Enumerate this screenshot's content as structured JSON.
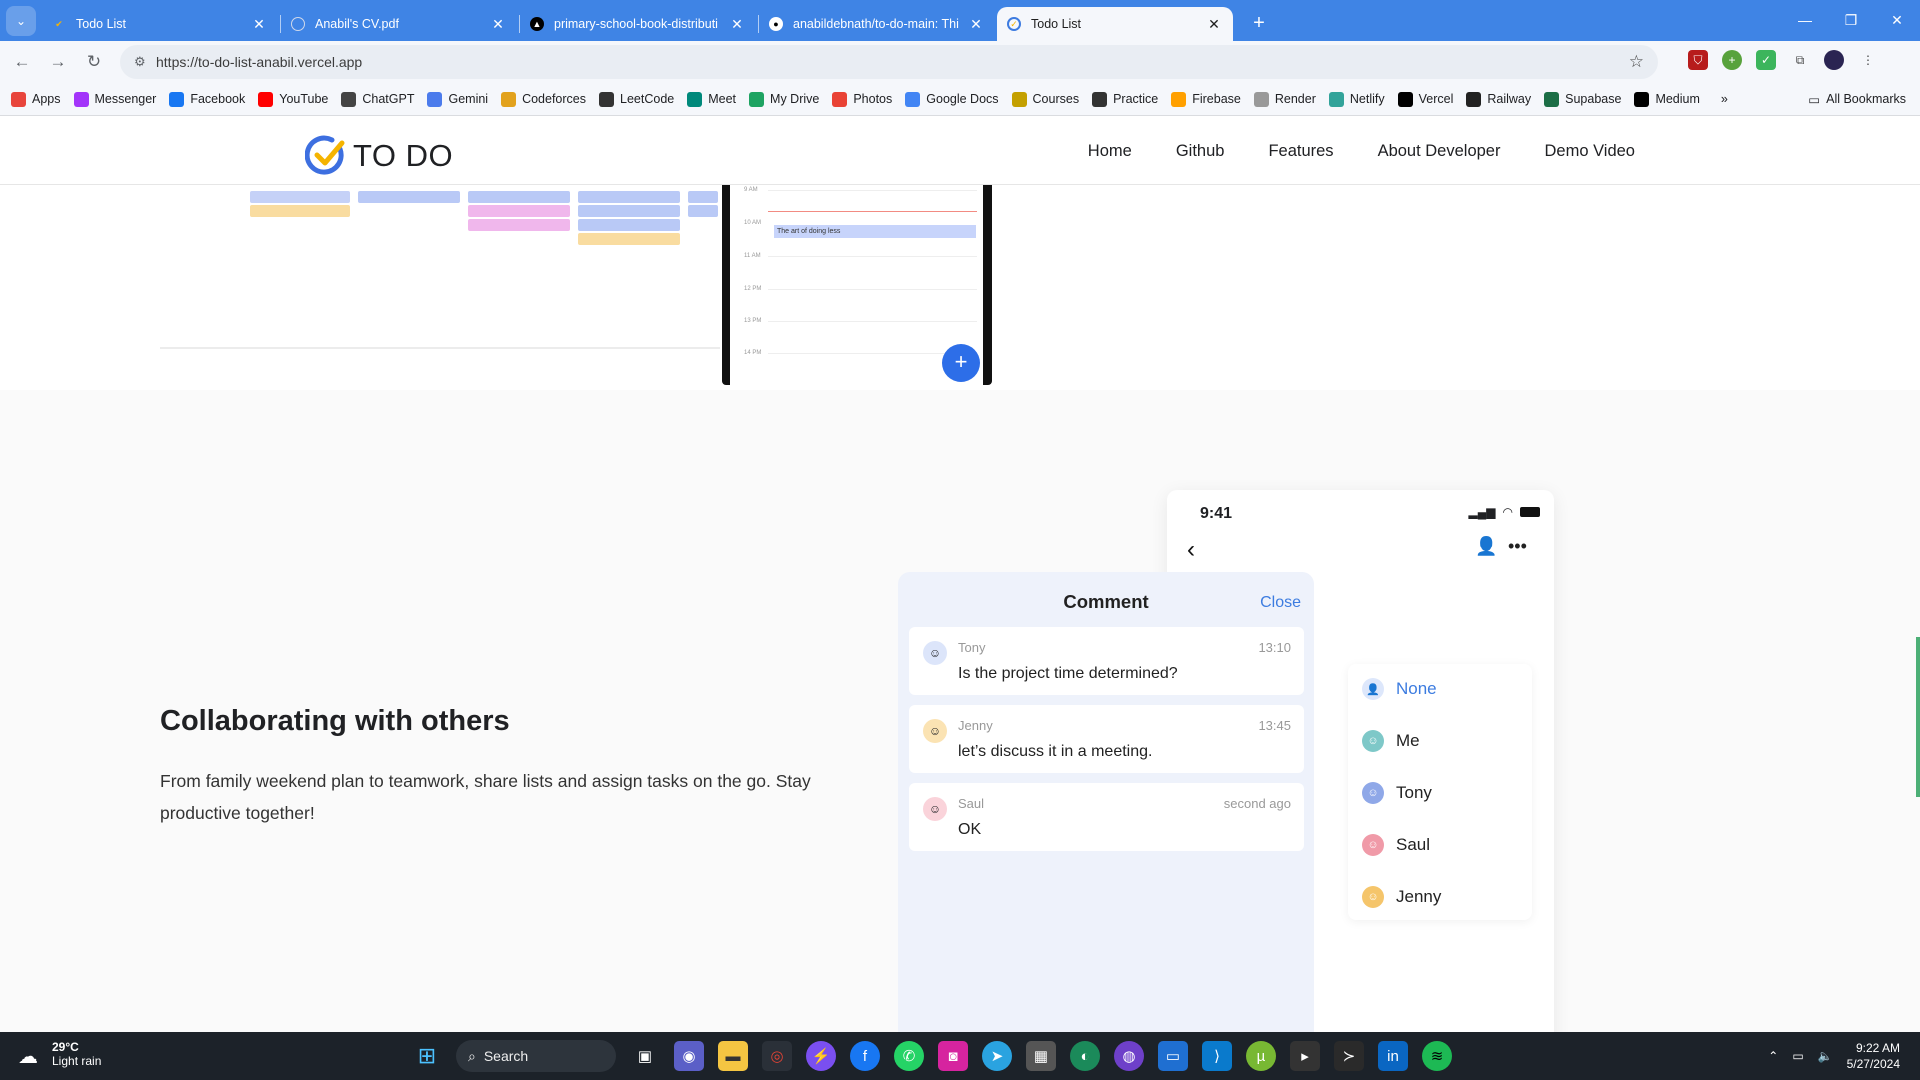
{
  "tabs": [
    {
      "title": "Todo List",
      "active": false
    },
    {
      "title": "Anabil's CV.pdf",
      "active": false
    },
    {
      "title": "primary-school-book-distributi",
      "active": false
    },
    {
      "title": "anabildebnath/to-do-main: Thi",
      "active": false
    },
    {
      "title": "Todo List",
      "active": true
    }
  ],
  "address_bar": {
    "url": "https://to-do-list-anabil.vercel.app"
  },
  "bookmarks": [
    {
      "label": "Apps",
      "icon": "apps-grid-icon",
      "color": "#e8453c"
    },
    {
      "label": "Messenger",
      "icon": "messenger-icon",
      "color": "#a334fa"
    },
    {
      "label": "Facebook",
      "icon": "facebook-icon",
      "color": "#1877f2"
    },
    {
      "label": "YouTube",
      "icon": "youtube-icon",
      "color": "#ff0000"
    },
    {
      "label": "ChatGPT",
      "icon": "chatgpt-icon",
      "color": "#444"
    },
    {
      "label": "Gemini",
      "icon": "gemini-icon",
      "color": "#4b7bec"
    },
    {
      "label": "Codeforces",
      "icon": "codeforces-icon",
      "color": "#e2a21d"
    },
    {
      "label": "LeetCode",
      "icon": "leetcode-icon",
      "color": "#333"
    },
    {
      "label": "Meet",
      "icon": "meet-icon",
      "color": "#00897b"
    },
    {
      "label": "My Drive",
      "icon": "drive-icon",
      "color": "#1ea362"
    },
    {
      "label": "Photos",
      "icon": "photos-icon",
      "color": "#e94235"
    },
    {
      "label": "Google Docs",
      "icon": "docs-icon",
      "color": "#4285f4"
    },
    {
      "label": "Courses",
      "icon": "courses-icon",
      "color": "#c4a000"
    },
    {
      "label": "Practice",
      "icon": "practice-icon",
      "color": "#333"
    },
    {
      "label": "Firebase",
      "icon": "firebase-icon",
      "color": "#ffa000"
    },
    {
      "label": "Render",
      "icon": "render-icon",
      "color": "#999"
    },
    {
      "label": "Netlify",
      "icon": "netlify-icon",
      "color": "#32a39a"
    },
    {
      "label": "Vercel",
      "icon": "vercel-icon",
      "color": "#000"
    },
    {
      "label": "Railway",
      "icon": "railway-icon",
      "color": "#222"
    },
    {
      "label": "Supabase",
      "icon": "supabase-icon",
      "color": "#1c6e46"
    },
    {
      "label": "Medium",
      "icon": "medium-icon",
      "color": "#000"
    }
  ],
  "bookmarks_more": "»",
  "all_bookmarks": "All Bookmarks",
  "site": {
    "logo_text": "TO DO",
    "nav": [
      "Home",
      "Github",
      "Features",
      "About Developer",
      "Demo Video"
    ]
  },
  "calendar_preview": {
    "times": [
      "9 AM",
      "10 AM",
      "11 AM",
      "12 PM",
      "13 PM",
      "14 PM"
    ],
    "event": "The art of doing less",
    "fab": "+"
  },
  "feature": {
    "title": "Collaborating with others",
    "description": "From family weekend plan to teamwork, share lists and assign tasks on the go. Stay productive together!"
  },
  "mockup": {
    "time": "9:41",
    "assignees": [
      {
        "name": "None",
        "selected": true
      },
      {
        "name": "Me",
        "selected": false
      },
      {
        "name": "Tony",
        "selected": false
      },
      {
        "name": "Saul",
        "selected": false
      },
      {
        "name": "Jenny",
        "selected": false
      }
    ],
    "comment_panel": {
      "title": "Comment",
      "close": "Close",
      "comments": [
        {
          "author": "Tony",
          "time": "13:10",
          "text": "Is the project time determined?"
        },
        {
          "author": "Jenny",
          "time": "13:45",
          "text": "let’s discuss it in a meeting."
        },
        {
          "author": "Saul",
          "time": "second ago",
          "text": "OK"
        }
      ]
    }
  },
  "taskbar": {
    "weather_temp": "29°C",
    "weather_desc": "Light rain",
    "search_label": "Search",
    "time": "9:22 AM",
    "date": "5/27/2024"
  }
}
